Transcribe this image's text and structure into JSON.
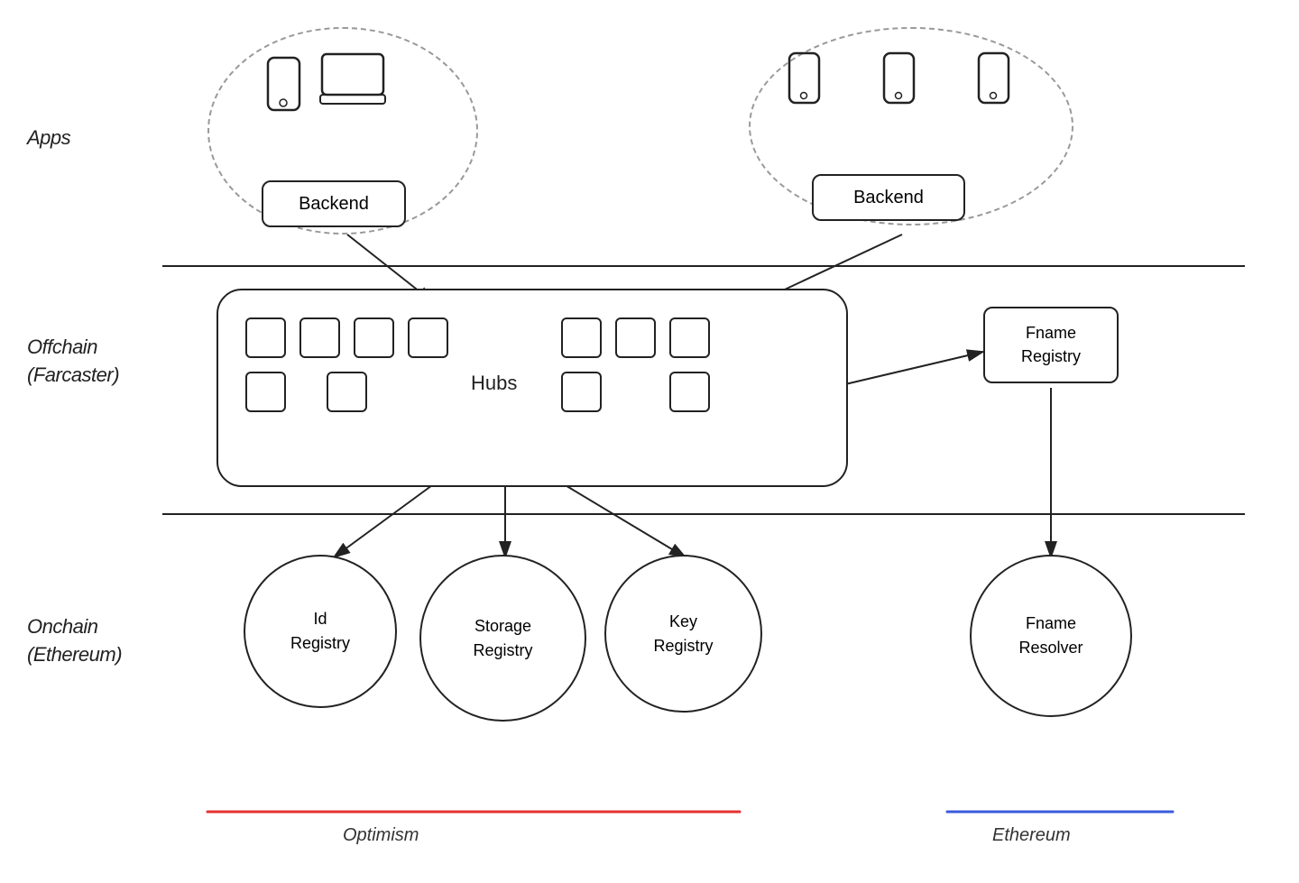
{
  "layers": {
    "apps_label": "Apps",
    "offchain_label": "Offchain\n(Farcaster)",
    "onchain_label": "Onchain\n(Ethereum)"
  },
  "components": {
    "backend1": "Backend",
    "backend2": "Backend",
    "hubs": "Hubs",
    "fname_registry": "Fname\nRegistry",
    "id_registry": "Id\nRegistry",
    "storage_registry": "Storage\nRegistry",
    "key_registry": "Key\nRegistry",
    "fname_resolver": "Fname\nResolver"
  },
  "chains": {
    "optimism_label": "Optimism",
    "ethereum_label": "Ethereum",
    "optimism_color": "#e63030",
    "ethereum_color": "#3b5bdb"
  }
}
